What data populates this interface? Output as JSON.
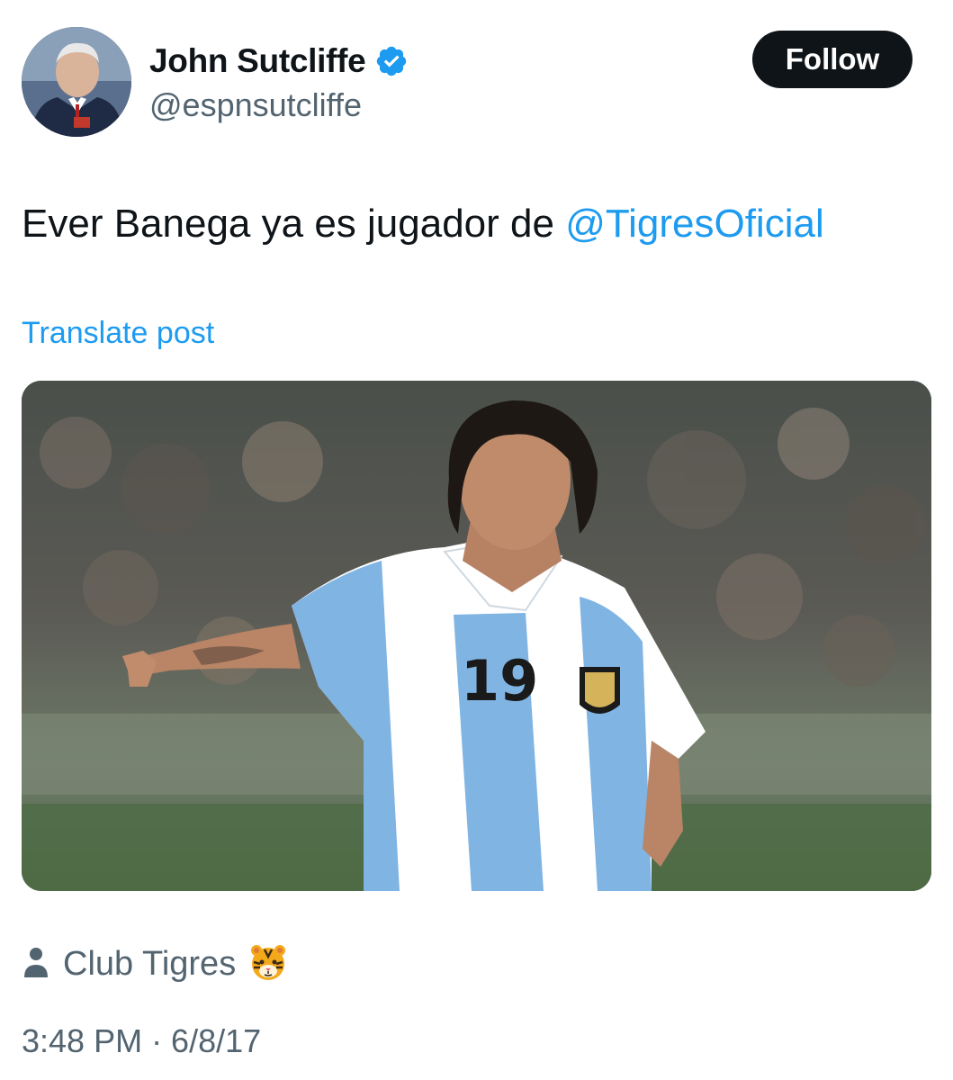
{
  "author": {
    "display_name": "John Sutcliffe",
    "handle": "@espnsutcliffe",
    "verified": true,
    "avatar_icon": "avatar-photo"
  },
  "follow_button": {
    "label": "Follow"
  },
  "post": {
    "text_prefix": "Ever Banega ya es jugador de ",
    "mention": "@TigresOficial",
    "translate_label": "Translate post"
  },
  "media": {
    "jersey_number": "19"
  },
  "location": {
    "icon": "person-icon",
    "label": "Club Tigres",
    "emoji": "🐯"
  },
  "timestamp": "3:48 PM · 6/8/17",
  "colors": {
    "link": "#1d9bf0",
    "text": "#0f1419",
    "secondary": "#536471",
    "follow_bg": "#0f1419",
    "verified": "#1d9bf0"
  }
}
